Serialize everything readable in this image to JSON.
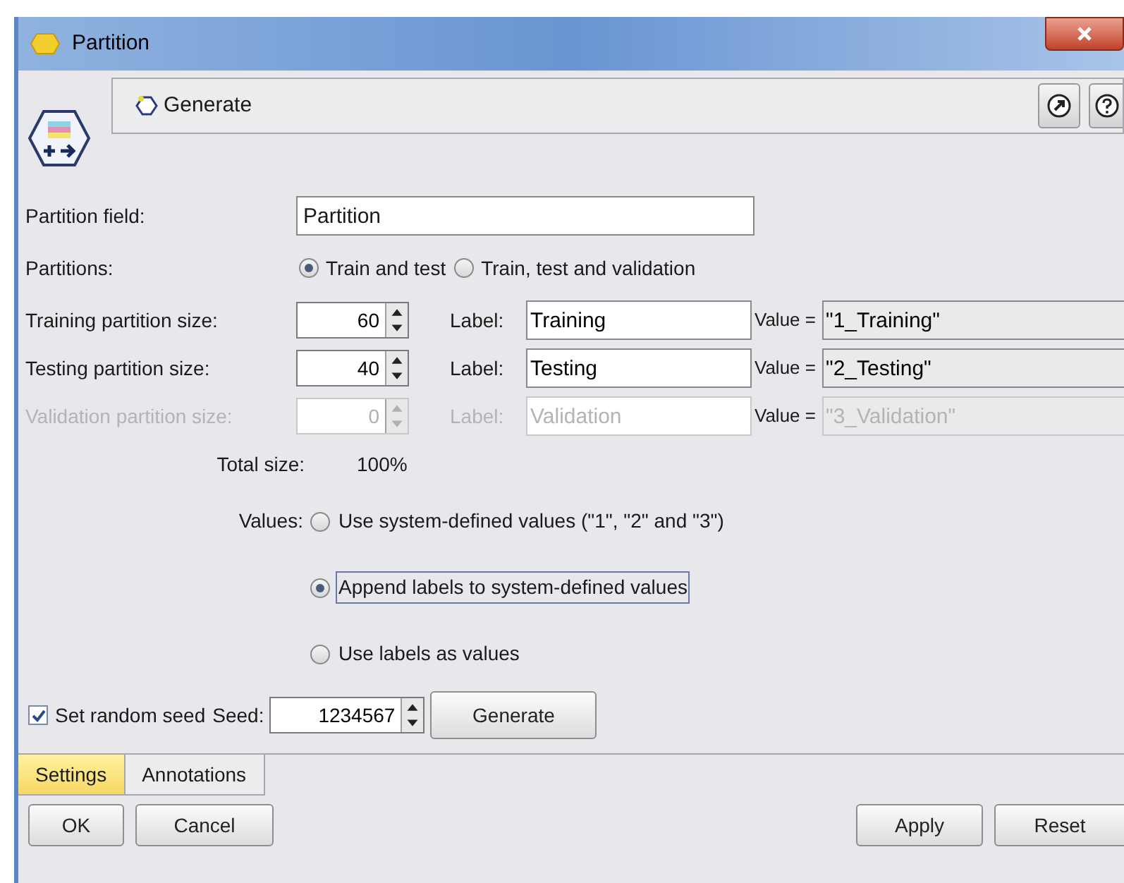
{
  "window": {
    "title": "Partition"
  },
  "toolbar": {
    "generate_label": "Generate"
  },
  "partition_field": {
    "label": "Partition field:",
    "value": "Partition"
  },
  "partitions": {
    "label": "Partitions:",
    "options": [
      {
        "label": "Train and test",
        "selected": true
      },
      {
        "label": "Train, test and validation",
        "selected": false
      }
    ]
  },
  "sizes": [
    {
      "label": "Training partition size:",
      "size": "60",
      "label_caption": "Label:",
      "name": "Training",
      "value_caption": "Value =",
      "value": "\"1_Training\"",
      "disabled": false
    },
    {
      "label": "Testing partition size:",
      "size": "40",
      "label_caption": "Label:",
      "name": "Testing",
      "value_caption": "Value =",
      "value": "\"2_Testing\"",
      "disabled": false
    },
    {
      "label": "Validation partition size:",
      "size": "0",
      "label_caption": "Label:",
      "name": "Validation",
      "value_caption": "Value =",
      "value": "\"3_Validation\"",
      "disabled": true
    }
  ],
  "total": {
    "label": "Total size:",
    "value": "100%"
  },
  "values": {
    "label": "Values:",
    "options": [
      {
        "label": "Use system-defined values (\"1\", \"2\" and \"3\")",
        "selected": false
      },
      {
        "label": "Append labels to system-defined values",
        "selected": true
      },
      {
        "label": "Use labels as values",
        "selected": false
      }
    ]
  },
  "seed": {
    "checkbox_label": "Set random seed",
    "checked": true,
    "label": "Seed:",
    "value": "1234567",
    "button": "Generate"
  },
  "tabs": [
    {
      "label": "Settings",
      "selected": true
    },
    {
      "label": "Annotations",
      "selected": false
    }
  ],
  "buttons_left": [
    "OK",
    "Cancel"
  ],
  "buttons_right": [
    "Apply",
    "Reset"
  ]
}
